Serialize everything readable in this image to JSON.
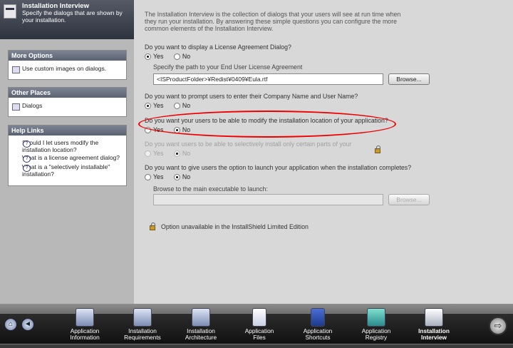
{
  "header": {
    "title": "Installation Interview",
    "subtitle": "Specify the dialogs that are shown by your installation."
  },
  "more_options": {
    "title": "More Options",
    "items": [
      {
        "label": "Use custom images on dialogs."
      }
    ]
  },
  "other_places": {
    "title": "Other Places",
    "items": [
      {
        "label": "Dialogs"
      }
    ]
  },
  "help_links": {
    "title": "Help Links",
    "items": [
      {
        "label": "Should I let users modify the installation location?"
      },
      {
        "label": "What is a license agreement dialog?"
      },
      {
        "label": "What is a \"selectively installable\" installation?"
      }
    ]
  },
  "intro": "The Installation Interview is the collection of dialogs that your users will see at run time when they run your installation. By answering these simple questions you can configure the more common elements of the Installation Interview.",
  "q1": {
    "text": "Do you want to display a License Agreement Dialog?",
    "yes": "Yes",
    "no": "No",
    "path_label": "Specify the path to your End User License Agreement",
    "path_value": "<ISProductFolder>¥Redist¥0409¥Eula.rtf",
    "browse": "Browse..."
  },
  "q2": {
    "text": "Do you want to prompt users to enter their Company Name and User Name?",
    "yes": "Yes",
    "no": "No"
  },
  "q3": {
    "text": "Do you want your users to be able to modify the installation location of your application?",
    "yes": "Yes",
    "no": "No"
  },
  "q4": {
    "text": "Do you want users to be able to selectively install only certain parts of your",
    "yes": "Yes",
    "no": "No"
  },
  "q5": {
    "text": "Do you want to give users the option to launch your application when the installation completes?",
    "yes": "Yes",
    "no": "No",
    "browse_label": "Browse to the main executable to launch:",
    "browse": "Browse..."
  },
  "note": "Option unavailable in the InstallShield Limited Edition",
  "taskbar": {
    "items": [
      {
        "label1": "Application",
        "label2": "Information"
      },
      {
        "label1": "Installation",
        "label2": "Requirements"
      },
      {
        "label1": "Installation",
        "label2": "Architecture"
      },
      {
        "label1": "Application",
        "label2": "Files"
      },
      {
        "label1": "Application",
        "label2": "Shortcuts"
      },
      {
        "label1": "Application",
        "label2": "Registry"
      },
      {
        "label1": "Installation",
        "label2": "Interview"
      }
    ]
  }
}
